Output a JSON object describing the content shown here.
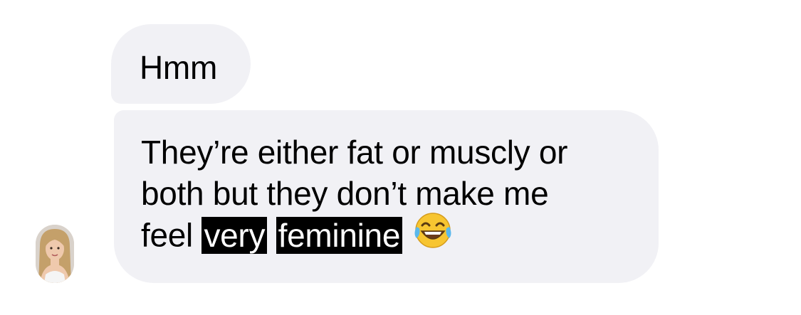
{
  "conversation": {
    "messages": [
      {
        "text": "Hmm"
      },
      {
        "lines": {
          "line1": "They’re either fat or muscly or",
          "line2": "both but they don’t make me",
          "line3_start": "feel",
          "highlight1": "very",
          "highlight2": "feminine"
        },
        "emoji_icon": "face-with-tears-of-joy-emoji"
      }
    ],
    "avatar_icon": "contact-avatar-photo"
  },
  "colors": {
    "bubble_background": "#f1f1f5",
    "text": "#000000",
    "redaction_highlight": "#000000"
  }
}
